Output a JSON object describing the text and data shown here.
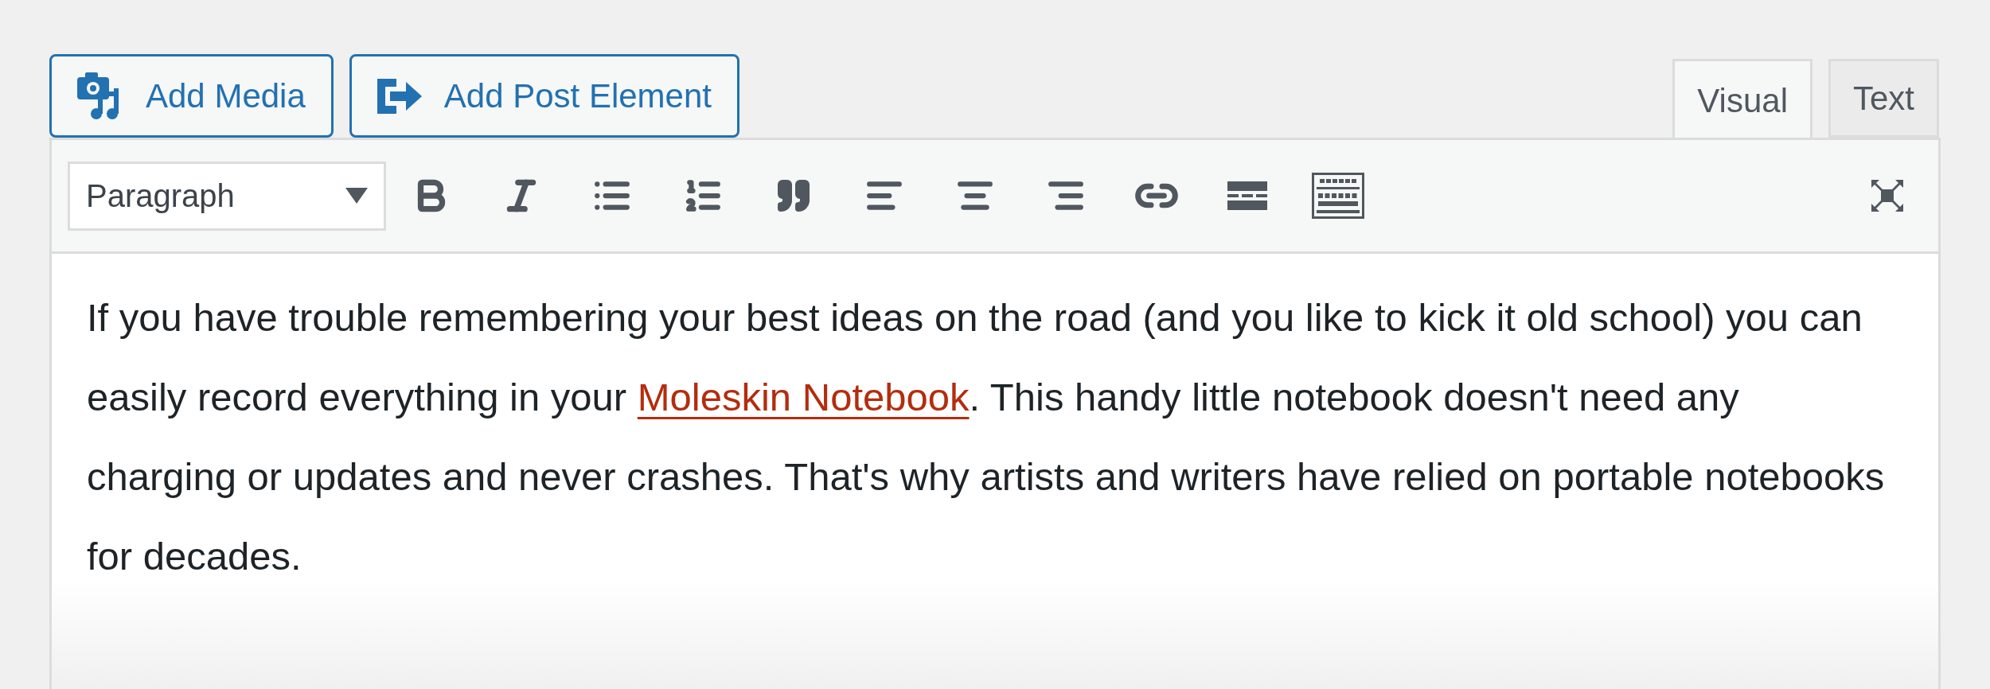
{
  "media_buttons": [
    {
      "kind": "media",
      "label": "Add Media"
    },
    {
      "kind": "element",
      "label": "Add Post Element"
    }
  ],
  "tabs": [
    {
      "label": "Visual",
      "selected": true
    },
    {
      "label": "Text",
      "selected": false
    }
  ],
  "format_select": {
    "value": "Paragraph"
  },
  "body": {
    "before": "If you have trouble remembering your best ideas on the road (and you like to kick it old school) you can easily record everything in your ",
    "link": "Moleskin Notebook",
    "after": ". This handy little notebook doesn't need any charging or updates and never crashes. That's why artists and writers have relied on portable notebooks for decades."
  }
}
